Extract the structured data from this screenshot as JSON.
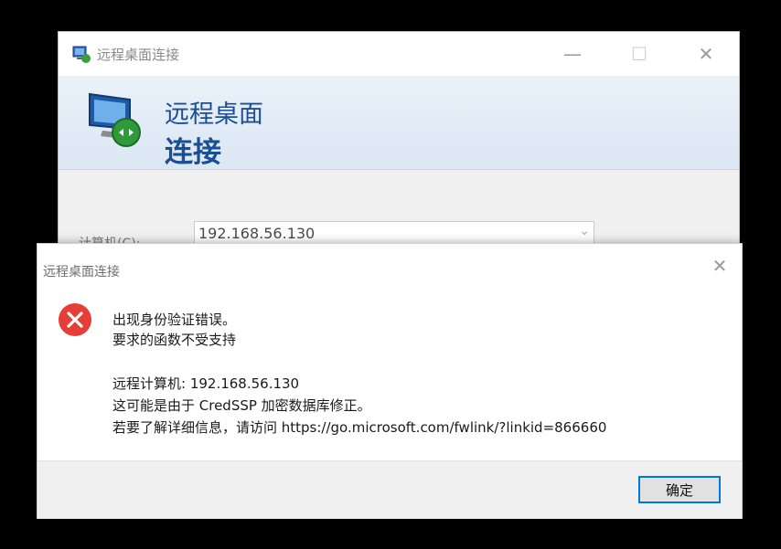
{
  "main_window": {
    "title": "远程桌面连接",
    "header_line1": "远程桌面",
    "header_line2": "连接",
    "computer_label": "计算机(C):",
    "computer_value": "192.168.56.130",
    "controls": {
      "minimize": "—",
      "maximize": "☐",
      "close": "✕"
    }
  },
  "error_dialog": {
    "title": "远程桌面连接",
    "close": "✕",
    "messages": [
      "出现身份验证错误。",
      "要求的函数不受支持",
      "远程计算机: 192.168.56.130",
      "这可能是由于 CredSSP 加密数据库修正。",
      "若要了解详细信息，请访问 https://go.microsoft.com/fwlink/?linkid=866660"
    ],
    "ok_label": "确定",
    "icon": "error-icon",
    "colors": {
      "error_red": "#e43e37",
      "accent": "#0078d7",
      "header_blue": "#1b4f93"
    }
  }
}
